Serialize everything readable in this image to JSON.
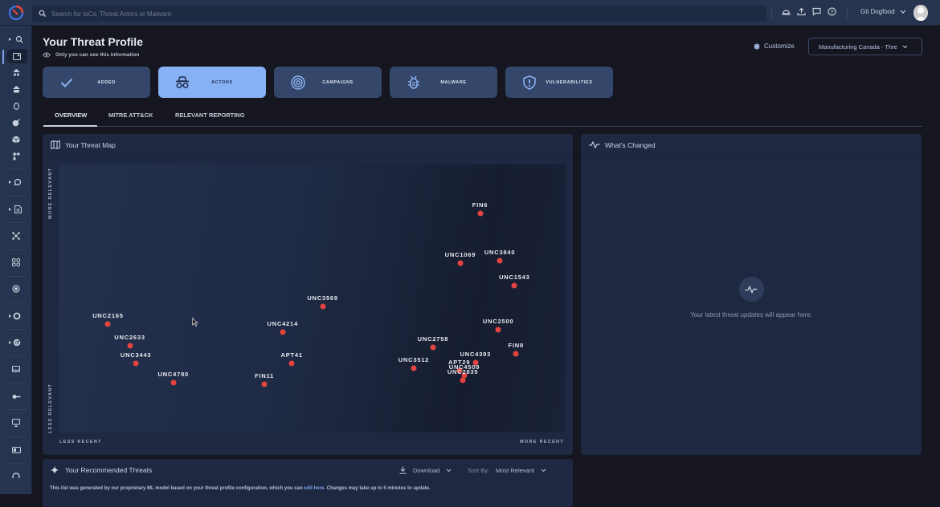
{
  "topbar": {
    "search_placeholder": "Search for IoCs, Threat Actors or Malware",
    "icons": [
      "bell-dome-icon",
      "upload-icon",
      "chat-icon",
      "help-icon"
    ],
    "user_name": "Gti Dogfood"
  },
  "sidebar": {
    "items": [
      {
        "icon": "threat-search-icon",
        "expandable": true
      },
      {
        "icon": "threat-profile-icon",
        "active": true
      },
      {
        "icon": "actor-icon"
      },
      {
        "icon": "actor-alt-icon"
      },
      {
        "icon": "malware-icon"
      },
      {
        "icon": "campaign-icon"
      },
      {
        "icon": "package-icon"
      },
      {
        "icon": "graph-icon"
      },
      {
        "icon": "hunt-icon",
        "expandable": true
      },
      {
        "icon": "reports-icon",
        "expandable": true
      },
      {
        "icon": "network-icon"
      },
      {
        "icon": "integrations-icon"
      },
      {
        "icon": "target-icon"
      },
      {
        "icon": "ring-icon",
        "expandable": true
      },
      {
        "icon": "radar-icon",
        "expandable": true
      },
      {
        "icon": "inbox-icon"
      },
      {
        "icon": "key-icon"
      },
      {
        "icon": "monitor-icon"
      },
      {
        "icon": "card-icon"
      },
      {
        "icon": "refresh-icon"
      }
    ]
  },
  "header": {
    "title": "Your Threat Profile",
    "subtitle": "Only you can see this information",
    "customize_label": "Customize",
    "profile_select": "Manufacturing Canada - Thre"
  },
  "cards": [
    {
      "label": "ADDED",
      "icon": "check-icon",
      "active": false
    },
    {
      "label": "ACTORS",
      "icon": "spy-icon",
      "active": true
    },
    {
      "label": "CAMPAIGNS",
      "icon": "target-icon",
      "active": false
    },
    {
      "label": "MALWARE",
      "icon": "bug-icon",
      "active": false
    },
    {
      "label": "VULNERABILITIES",
      "icon": "shield-alert-icon",
      "active": false
    }
  ],
  "tabs": [
    {
      "label": "OVERVIEW",
      "active": true
    },
    {
      "label": "MITRE ATT&CK",
      "active": false
    },
    {
      "label": "RELEVANT REPORTING",
      "active": false
    }
  ],
  "threat_map": {
    "title": "Your Threat Map",
    "y_top": "MORE RELEVANT",
    "y_bottom": "LESS RELEVANT",
    "x_left": "LESS RECENT",
    "x_right": "MORE RECENT",
    "dot_color": "#e5433f",
    "actors": [
      {
        "name": "FIN6",
        "recency": 0.831,
        "relevance": 0.817
      },
      {
        "name": "UNC1069",
        "recency": 0.792,
        "relevance": 0.632
      },
      {
        "name": "UNC3840",
        "recency": 0.87,
        "relevance": 0.641
      },
      {
        "name": "UNC1543",
        "recency": 0.899,
        "relevance": 0.548
      },
      {
        "name": "UNC3569",
        "recency": 0.52,
        "relevance": 0.47
      },
      {
        "name": "UNC2165",
        "recency": 0.096,
        "relevance": 0.404
      },
      {
        "name": "UNC4214",
        "recency": 0.441,
        "relevance": 0.374
      },
      {
        "name": "UNC2633",
        "recency": 0.139,
        "relevance": 0.323
      },
      {
        "name": "UNC2500",
        "recency": 0.867,
        "relevance": 0.383
      },
      {
        "name": "UNC2758",
        "recency": 0.738,
        "relevance": 0.317
      },
      {
        "name": "APT41",
        "recency": 0.459,
        "relevance": 0.257
      },
      {
        "name": "FIN8",
        "recency": 0.902,
        "relevance": 0.293
      },
      {
        "name": "UNC4393",
        "recency": 0.822,
        "relevance": 0.26
      },
      {
        "name": "UNC3512",
        "recency": 0.7,
        "relevance": 0.24
      },
      {
        "name": "UNC3443",
        "recency": 0.151,
        "relevance": 0.257
      },
      {
        "name": "UNC4780",
        "recency": 0.225,
        "relevance": 0.186
      },
      {
        "name": "FIN11",
        "recency": 0.405,
        "relevance": 0.18
      },
      {
        "name": "APT29",
        "recency": 0.79,
        "relevance": 0.231
      },
      {
        "name": "UNC4509",
        "recency": 0.8,
        "relevance": 0.213
      },
      {
        "name": "UNC2835",
        "recency": 0.797,
        "relevance": 0.195
      }
    ]
  },
  "whats_changed": {
    "title": "What's Changed",
    "empty_text": "Your latest threat updates will appear here."
  },
  "recommended": {
    "title": "Your Recommended Threats",
    "download_label": "Download",
    "sort_label": "Sort By:",
    "sort_value": "Most Relevant",
    "note_before": "This list was generated by our proprietary ML model based on your threat profile configuration, which you can ",
    "note_link": "edit here",
    "note_after": ". Changes may take up to 5 minutes to update."
  }
}
